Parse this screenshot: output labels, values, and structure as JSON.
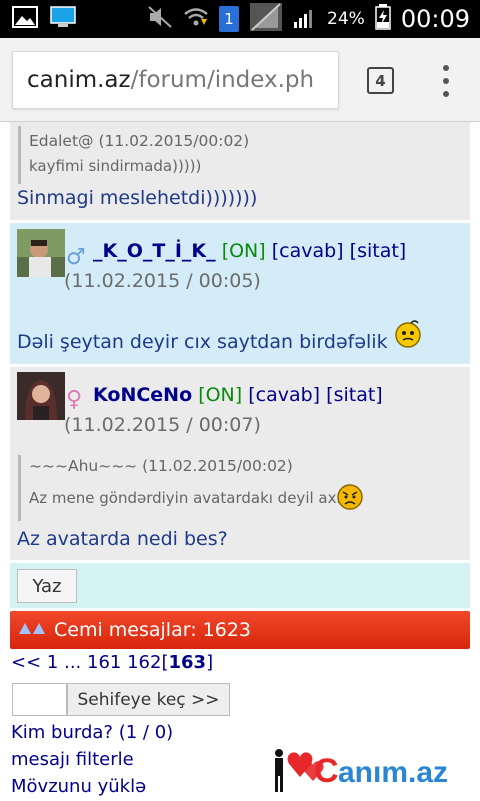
{
  "status_bar": {
    "time": "00:09",
    "battery_percent": "24%",
    "sim_badge": "1"
  },
  "browser": {
    "url_host": "canim.az",
    "url_path": "/forum/index.ph",
    "tab_count": "4"
  },
  "posts": [
    {
      "quote_author": "Edalet@ (11.02.2015/00:02)",
      "quote_text": "kayfimi sindirmada)))))",
      "text": "Sinmagi meslehetdi)))))))"
    },
    {
      "username": "_K_O_T_İ_K_",
      "status": "[ON]",
      "reply": "[cavab]",
      "quote": "[sitat]",
      "date": "(11.02.2015 / 00:05)",
      "text": "Dəli şeytan deyir cıx saytdan birdəfəlik"
    },
    {
      "username": "KoNCeNo",
      "status": "[ON]",
      "reply": "[cavab]",
      "quote": "[sitat]",
      "date_part1": "(11.02.2015 /",
      "date_part2": "00:07)",
      "quote_author": "~~~Ahu~~~ (11.02.2015/00:02)",
      "quote_text": "Az mene göndərdiyin avatardakı deyil axı",
      "text": "Az avatarda nedi bes?"
    }
  ],
  "reply_button": "Yaz",
  "total_messages": "Cemi mesajlar: 1623",
  "pager": {
    "first": "<<",
    "p1": "1",
    "ellipsis": "...",
    "p161": "161",
    "p162": "162",
    "current": "163"
  },
  "page_jump_button": "Sehifeye keç >>",
  "links": {
    "who": "Kim burda? (1 / 0)",
    "filter": "mesajı filterle",
    "load": "Mövzunu yüklə"
  },
  "logo_text": "anım.az"
}
